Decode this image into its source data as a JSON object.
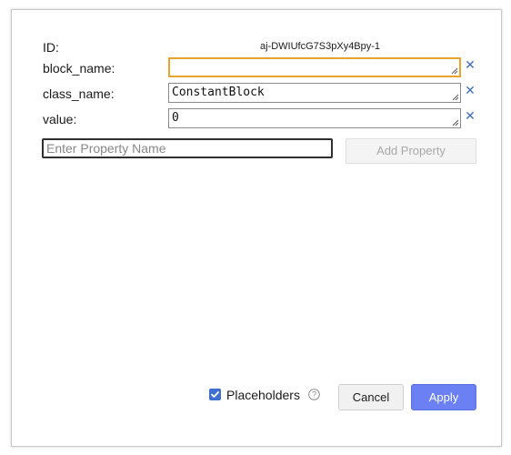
{
  "dialog": {
    "id_label": "ID:",
    "id_value": "aj-DWIUfcG7S3pXy4Bpy-1",
    "properties": [
      {
        "name": "block_name:",
        "value": ""
      },
      {
        "name": "class_name:",
        "value": "ConstantBlock"
      },
      {
        "name": "value:",
        "value": "0"
      }
    ],
    "remove_icon": "close-icon",
    "new_property": {
      "placeholder": "Enter Property Name",
      "value": ""
    },
    "add_property_label": "Add Property",
    "placeholders": {
      "label": "Placeholders",
      "checked": true,
      "help_icon": "help-circle-icon"
    },
    "cancel_label": "Cancel",
    "apply_label": "Apply"
  },
  "colors": {
    "focus_border": "#e9a42c",
    "accent": "#6b80f2",
    "checkbox": "#3f6fd1",
    "remove_icon": "#3d6fb3"
  }
}
